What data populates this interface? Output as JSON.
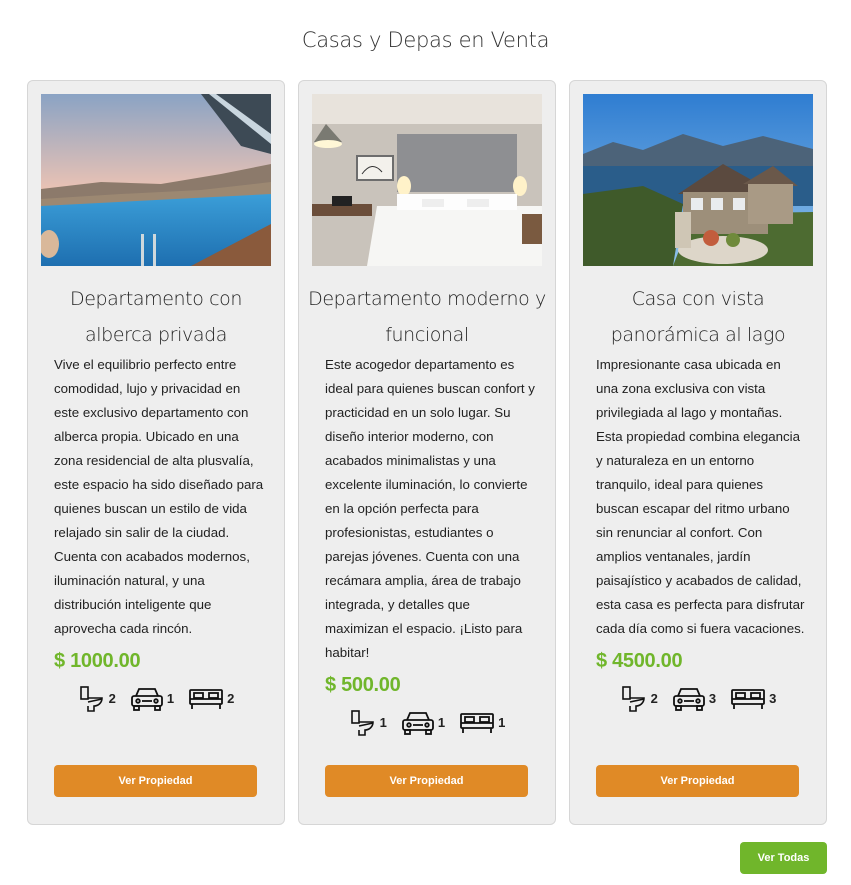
{
  "page": {
    "title": "Casas y Depas en Venta",
    "view_all_label": "Ver Todas"
  },
  "colors": {
    "accent_orange": "#e08a26",
    "accent_green": "#70b62b",
    "card_bg": "#eeeeee"
  },
  "listings": [
    {
      "title": "Departamento con alberca privada",
      "description": "Vive el equilibrio perfecto entre comodidad, lujo y privacidad en este exclusivo departamento con alberca propia. Ubicado en una zona residencial de alta plusvalía, este espacio ha sido diseñado para quienes buscan un estilo de vida relajado sin salir de la ciudad. Cuenta con acabados modernos, iluminación natural, y una distribución inteligente que aprovecha cada rincón.",
      "price": "$ 1000.00",
      "bathrooms": "2",
      "parking": "1",
      "bedrooms": "2",
      "button_label": "Ver Propiedad"
    },
    {
      "title": "Departamento moderno y funcional",
      "description": "Este acogedor departamento es ideal para quienes buscan confort y practicidad en un solo lugar. Su diseño interior moderno, con acabados minimalistas y una excelente iluminación, lo convierte en la opción perfecta para profesionistas, estudiantes o parejas jóvenes. Cuenta con una recámara amplia, área de trabajo integrada, y detalles que maximizan el espacio. ¡Listo para habitar!",
      "price": "$ 500.00",
      "bathrooms": "1",
      "parking": "1",
      "bedrooms": "1",
      "button_label": "Ver Propiedad"
    },
    {
      "title": "Casa con vista panorámica al lago",
      "description": "Impresionante casa ubicada en una zona exclusiva con vista privilegiada al lago y montañas. Esta propiedad combina elegancia y naturaleza en un entorno tranquilo, ideal para quienes buscan escapar del ritmo urbano sin renunciar al confort. Con amplios ventanales, jardín paisajístico y acabados de calidad, esta casa es perfecta para disfrutar cada día como si fuera vacaciones.",
      "price": "$ 4500.00",
      "bathrooms": "2",
      "parking": "3",
      "bedrooms": "3",
      "button_label": "Ver Propiedad"
    }
  ],
  "icons": {
    "bathroom": "toilet-icon",
    "parking": "car-icon",
    "bedroom": "bed-icon"
  }
}
